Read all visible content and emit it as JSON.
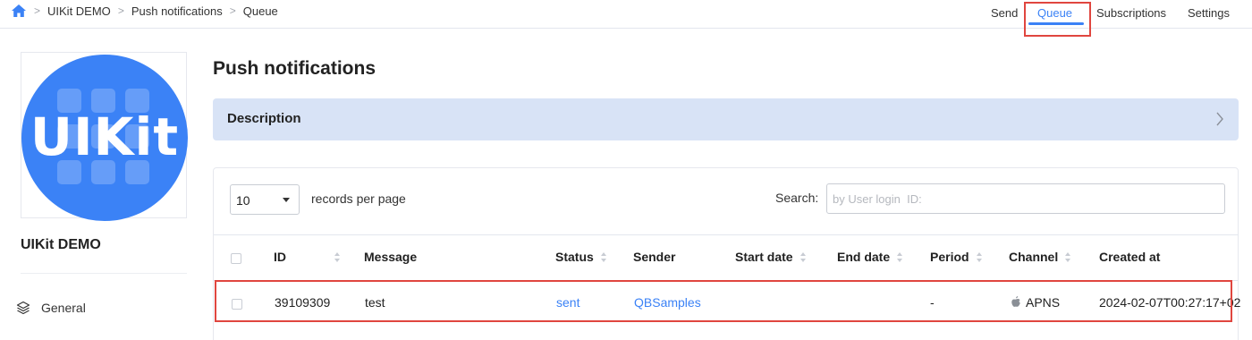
{
  "breadcrumb": {
    "items": [
      "UIKit DEMO",
      "Push notifications",
      "Queue"
    ]
  },
  "top_nav": {
    "send": "Send",
    "queue": "Queue",
    "subscriptions": "Subscriptions",
    "settings": "Settings",
    "active": "Queue"
  },
  "sidebar": {
    "logo_text": "UIKit",
    "app_name": "UIKit DEMO",
    "menu": [
      {
        "label": "General",
        "icon": "layers-icon"
      }
    ]
  },
  "main": {
    "title": "Push notifications",
    "description_label": "Description",
    "per_page_value": "10",
    "records_per_page_label": "records per page",
    "search_label": "Search:",
    "search_placeholder": "by User login  ID:",
    "columns": [
      "ID",
      "Message",
      "Status",
      "Sender",
      "Start date",
      "End date",
      "Period",
      "Channel",
      "Created at"
    ],
    "rows": [
      {
        "id": "39109309",
        "message": "test",
        "status": "sent",
        "sender": "QBSamples",
        "start_date": "",
        "end_date": "",
        "period": "-",
        "channel": "APNS",
        "created_at": "2024-02-07T00:27:17+02"
      }
    ]
  },
  "colors": {
    "accent": "#3b82f6",
    "description_bg": "#d8e3f6",
    "highlight": "#e0463f"
  }
}
